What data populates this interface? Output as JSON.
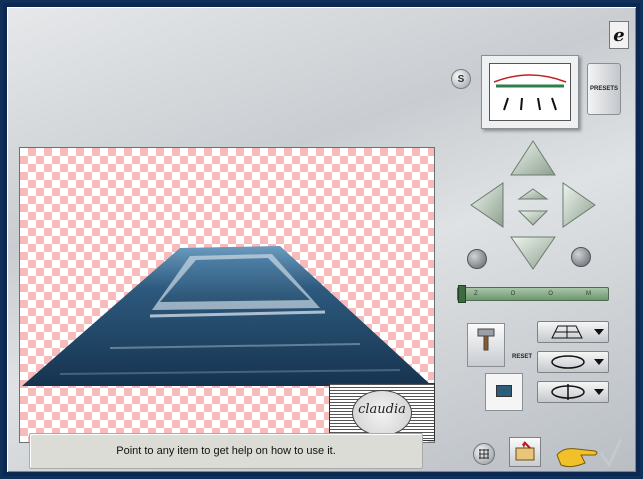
{
  "help_text": "Point to any item to get help on how to use it.",
  "buttons": {
    "presets_label": "PRESETS",
    "reset_label": "RESET",
    "s_label": "S"
  },
  "logo": {
    "glyph": "e",
    "text": "claudia"
  },
  "zoom": {
    "letters": [
      "Z",
      "O",
      "O",
      "M"
    ],
    "level": 0.0
  },
  "colors": {
    "panel": "#d4d7da",
    "checker_pink": "#f6bcbc",
    "road_blue": "#2d5a7e",
    "accent_yellow": "#f1c02a"
  },
  "icons": {
    "arrow_up": "arrow-up-icon",
    "arrow_down": "arrow-down-icon",
    "arrow_left": "arrow-left-icon",
    "arrow_right": "arrow-right-icon",
    "grid": "grid-icon",
    "folder": "folder-icon",
    "hand": "hand-pointer-icon",
    "hammer": "hammer-icon"
  }
}
